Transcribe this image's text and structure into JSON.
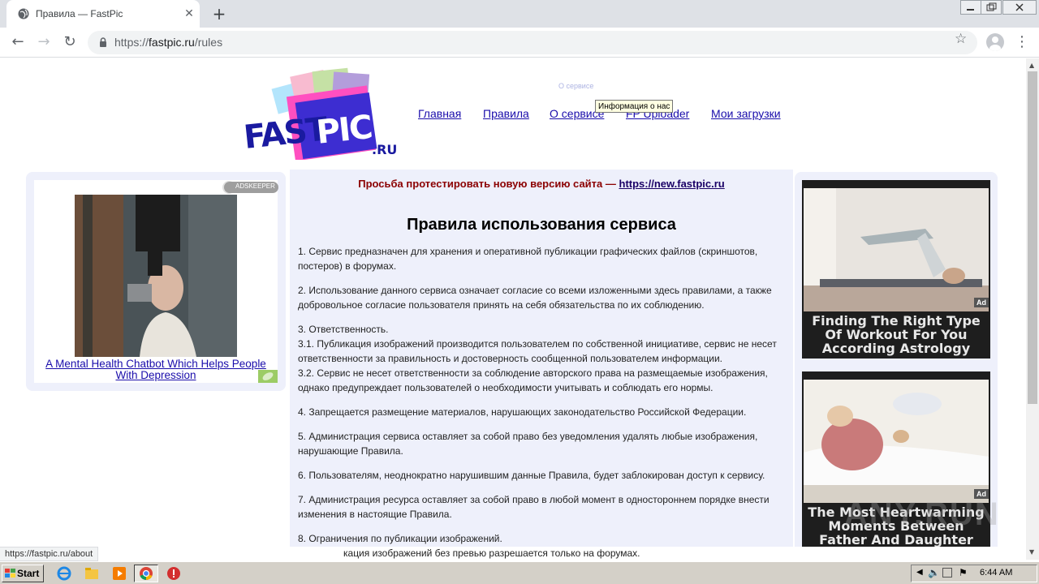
{
  "browser": {
    "tab_title": "Правила — FastPic",
    "url_prefix": "https://",
    "url_host": "fastpic.ru",
    "url_path": "/rules",
    "status_url": "https://fastpic.ru/about"
  },
  "site": {
    "nav": [
      "Главная",
      "Правила",
      "О сервисе",
      "FP Uploader",
      "Мои загрузки"
    ],
    "tooltip": "Информация о нас",
    "ghost_text": "О сервисе"
  },
  "left_ad": {
    "badge": "ADSKEEPER",
    "link": "A Mental Health Chatbot Which Helps People With Depression"
  },
  "main": {
    "notice_text": "Просьба протестировать новую версию сайта — ",
    "notice_link": "https://new.fastpic.ru",
    "title": "Правила использования сервиса",
    "rules": [
      "1. Сервис предназначен для хранения и оперативной публикации графических файлов (скриншотов, постеров) в форумах.",
      "2. Использование данного сервиса означает согласие со всеми изложенными здесь правилами, а также добровольное согласие пользователя принять на себя обязательства по их соблюдению.",
      "3. Ответственность.\n3.1. Публикация изображений производится пользователем по собственной инициативе, сервис не несет ответственности за правильность и достоверность сообщенной пользователем информации.\n3.2. Сервис не несет ответственности за соблюдение авторского права на размещаемые изображения, однако предупреждает пользователей о необходимости учитывать и соблюдать его нормы.",
      "4. Запрещается размещение материалов, нарушающих законодательство Российской Федерации.",
      "5. Администрация сервиса оставляет за собой право без уведомления удалять любые изображения, нарушающие Правила.",
      "6. Пользователям, неоднократно нарушившим данные Правила, будет заблокирован доступ к сервису.",
      "7. Администрация ресурса оставляет за собой право в любой момент в одностороннем порядке внести изменения в настоящие Правила.",
      "8. Ограничения по публикации изображений."
    ],
    "partial_line": "кация изображений без превью разрешается только на форумах."
  },
  "right_ad": {
    "cards": [
      {
        "caption": "Finding The Right Type Of Workout For You According Astrology",
        "badge": "Ad"
      },
      {
        "caption": "The Most Heartwarming Moments Between Father And Daughter",
        "badge": "Ad"
      }
    ]
  },
  "watermark": "ANY.RUN",
  "taskbar": {
    "start": "Start",
    "clock": "6:44 AM"
  }
}
